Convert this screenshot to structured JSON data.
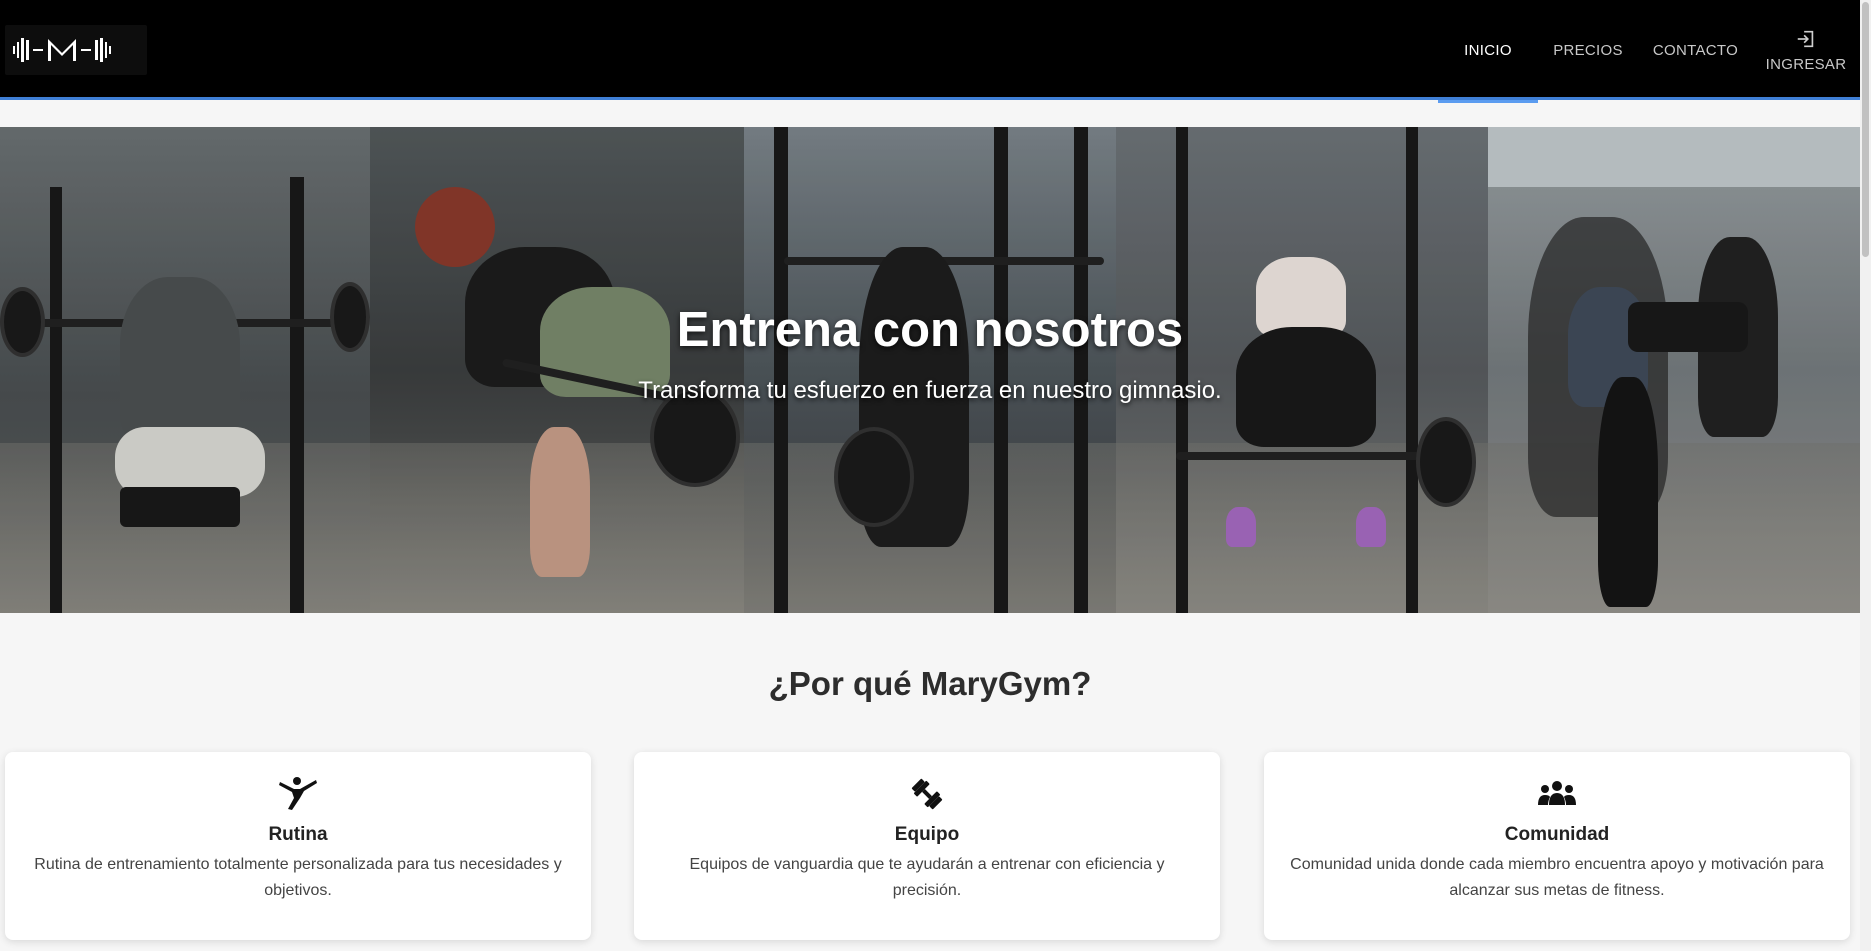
{
  "brand": {
    "logo_icon": "marygym-logo-icon"
  },
  "nav": {
    "items": [
      {
        "label": "INICIO",
        "active": true
      },
      {
        "label": "PRECIOS",
        "active": false
      },
      {
        "label": "CONTACTO",
        "active": false
      }
    ],
    "login": {
      "label": "INGRESAR",
      "icon": "login-icon"
    },
    "accent_color": "#3f7fd6"
  },
  "hero": {
    "title": "Entrena con nosotros",
    "subtitle": "Transforma tu esfuerzo en fuerza en nuestro gimnasio."
  },
  "features": {
    "title": "¿Por qué MaryGym?",
    "cards": [
      {
        "icon": "martial-arts-kick-icon",
        "title": "Rutina",
        "description": "Rutina de entrenamiento totalmente personalizada para tus necesidades y objetivos."
      },
      {
        "icon": "dumbbell-icon",
        "title": "Equipo",
        "description": "Equipos de vanguardia que te ayudarán a entrenar con eficiencia y precisión."
      },
      {
        "icon": "users-group-icon",
        "title": "Comunidad",
        "description": "Comunidad unida donde cada miembro encuentra apoyo y motivación para alcanzar sus metas de fitness."
      }
    ]
  }
}
